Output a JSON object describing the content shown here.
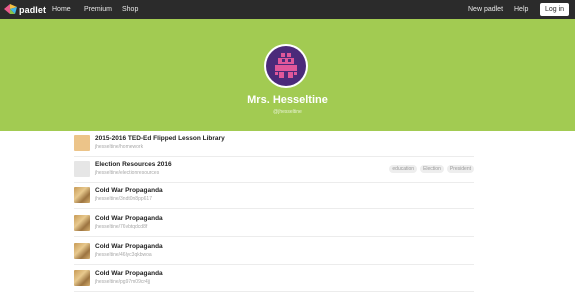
{
  "nav": {
    "logo_text": "padlet",
    "home": "Home",
    "premium": "Premium",
    "shop": "Shop",
    "new_padlet": "New padlet",
    "help": "Help",
    "login": "Log in"
  },
  "profile": {
    "name": "Mrs. Hesseltine",
    "handle": "@jhesseltine"
  },
  "padlets": [
    {
      "title": "2015-2016 TED-Ed Flipped Lesson Library",
      "path": "jhesseltine/homework",
      "thumb": "tan",
      "tags": []
    },
    {
      "title": "Election Resources 2016",
      "path": "jhesseltine/electionresources",
      "thumb": "grey",
      "tags": [
        "education",
        "Election",
        "President"
      ]
    },
    {
      "title": "Cold War Propaganda",
      "path": "jhesseltine/3ndt0n8pp617",
      "thumb": "photo",
      "tags": []
    },
    {
      "title": "Cold War Propaganda",
      "path": "jhesseltine/76vbtqdcd8f",
      "thumb": "photo",
      "tags": []
    },
    {
      "title": "Cold War Propaganda",
      "path": "jhesseltine/46lyc3qkbwoa",
      "thumb": "photo",
      "tags": []
    },
    {
      "title": "Cold War Propaganda",
      "path": "jhesseltine/pg97m09cr4jj",
      "thumb": "photo",
      "tags": []
    }
  ],
  "colors": {
    "topbar": "#2b2b2b",
    "hero": "#a2cb52",
    "avatar_bg": "#4b2a7a",
    "avatar_pixels": "#e0579a"
  },
  "icons": {
    "logo": "padlet-logo-icon",
    "avatar": "pixel-monster-avatar"
  }
}
